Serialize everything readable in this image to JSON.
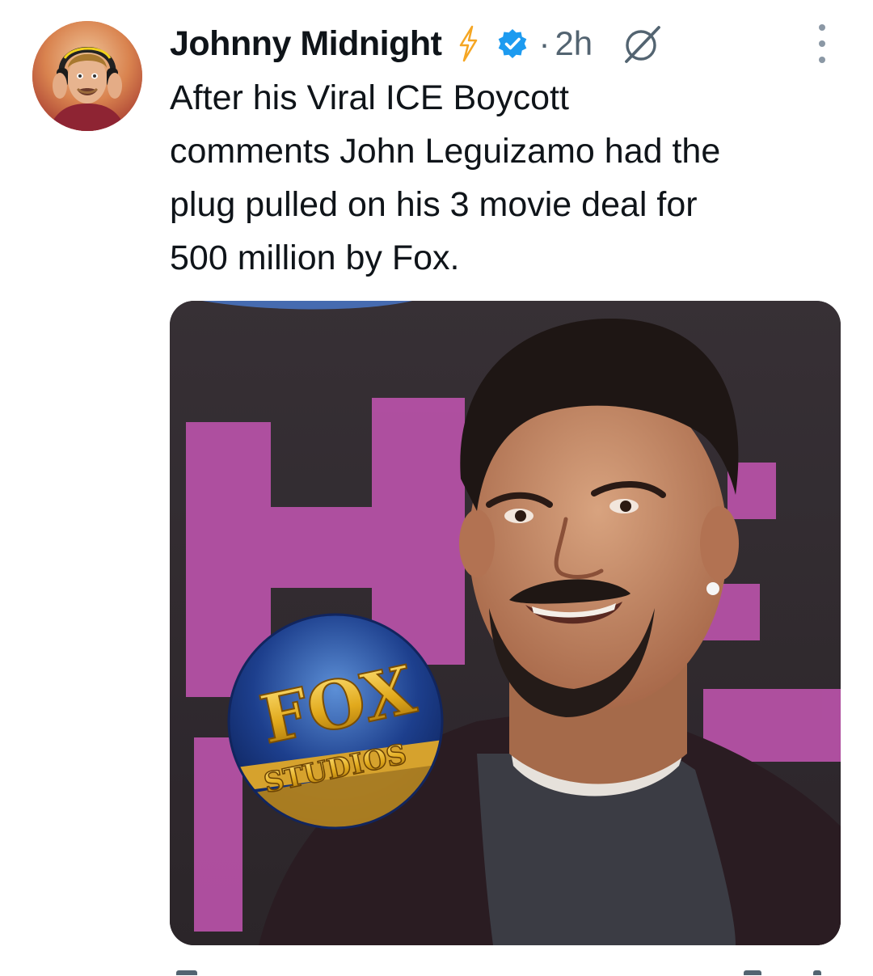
{
  "author": {
    "name": "Johnny Midnight",
    "time": "2h",
    "separator": "·",
    "avatar": "profile-avatar"
  },
  "icons": {
    "bolt": "lightning-bolt-icon",
    "verified": "verified-badge-icon",
    "grok": "grok-icon",
    "more": "more-options-icon"
  },
  "post": {
    "text": "After his Viral ICE Boycott\ncomments John Leguizamo had the\nplug pulled on his 3 movie deal for\n500 million by Fox."
  },
  "media": {
    "logo_top": "FOX",
    "logo_bottom": "STUDIOS"
  },
  "colors": {
    "accent": "#1d9bf0",
    "bolt": "#f5a623",
    "muted": "#536471"
  }
}
